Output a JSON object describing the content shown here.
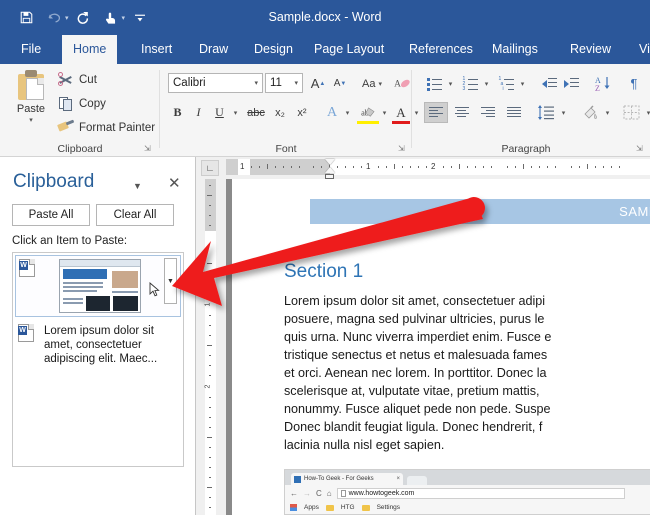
{
  "titlebar": {
    "document_title": "Sample.docx - Word",
    "quick_access": [
      {
        "name": "save",
        "glyph": "ὋE"
      },
      {
        "name": "undo",
        "glyph": "↶"
      },
      {
        "name": "redo",
        "glyph": "↻"
      },
      {
        "name": "touch-mode",
        "glyph": "☝"
      },
      {
        "name": "customize",
        "glyph": "⩝"
      }
    ]
  },
  "ribbon": {
    "tabs": [
      {
        "label": "File",
        "active": false
      },
      {
        "label": "Home",
        "active": true
      },
      {
        "label": "Insert",
        "active": false
      },
      {
        "label": "Draw",
        "active": false
      },
      {
        "label": "Design",
        "active": false
      },
      {
        "label": "Page Layout",
        "active": false
      },
      {
        "label": "References",
        "active": false
      },
      {
        "label": "Mailings",
        "active": false
      },
      {
        "label": "Review",
        "active": false
      },
      {
        "label": "Vi",
        "active": false
      }
    ],
    "clipboard_group": {
      "label": "Clipboard",
      "paste_label": "Paste",
      "cut_label": "Cut",
      "copy_label": "Copy",
      "format_painter_label": "Format Painter"
    },
    "font_group": {
      "label": "Font",
      "font_name": "Calibri",
      "font_size": "11",
      "bold": "B",
      "italic": "I",
      "underline": "U",
      "strikethrough": "abc",
      "subscript": "x₂",
      "superscript": "x²",
      "grow_font": "A",
      "shrink_font": "A",
      "change_case": "Aa",
      "text_effects": "A",
      "highlight": "ab",
      "font_color": "A",
      "clear_formatting": "A"
    },
    "paragraph_group": {
      "label": "Paragraph",
      "show_marks": "¶",
      "sort": "A\nZ"
    }
  },
  "clipboard_pane": {
    "title": "Clipboard",
    "paste_all_label": "Paste All",
    "clear_all_label": "Clear All",
    "hint": "Click an Item to Paste:",
    "items": [
      {
        "type": "image",
        "selected": true,
        "text": ""
      },
      {
        "type": "text",
        "selected": false,
        "text": "Lorem ipsum dolor sit amet, consectetuer adipiscing elit. Maec..."
      }
    ]
  },
  "ruler": {
    "horizontal_numbers": [
      "1",
      "1",
      "2"
    ],
    "vertical_numbers": [
      "1",
      "2"
    ]
  },
  "document": {
    "banner_text": "SAMP",
    "heading": "Section 1",
    "body": "Lorem ipsum dolor sit amet, consectetuer adipi\nposuere, magna sed pulvinar ultricies, purus le\nquis urna. Nunc viverra imperdiet enim. Fusce e\ntristique senectus et netus et malesuada fames\net orci. Aenean nec lorem. In porttitor. Donec la\nscelerisque at, vulputate vitae, pretium mattis,\nnonummy. Fusce aliquet pede non pede. Suspe\nDonec blandit feugiat ligula. Donec hendrerit, f\nlacinia nulla nisl eget sapien.",
    "screenshot": {
      "tab_title": "How-To Geek - For Geeks",
      "tab_close": "×",
      "url": "www.howtogeek.com",
      "back": "←",
      "forward": "→",
      "reload": "C",
      "home": "⌂",
      "bookmarks": [
        "Apps",
        "HTG",
        "Settings"
      ]
    }
  },
  "colors": {
    "word_blue": "#2b579a",
    "heading_blue": "#2e74b5",
    "pane_title_blue": "#2a6099",
    "banner_blue": "#a7c6e4",
    "arrow_red": "#ee1d1d"
  }
}
